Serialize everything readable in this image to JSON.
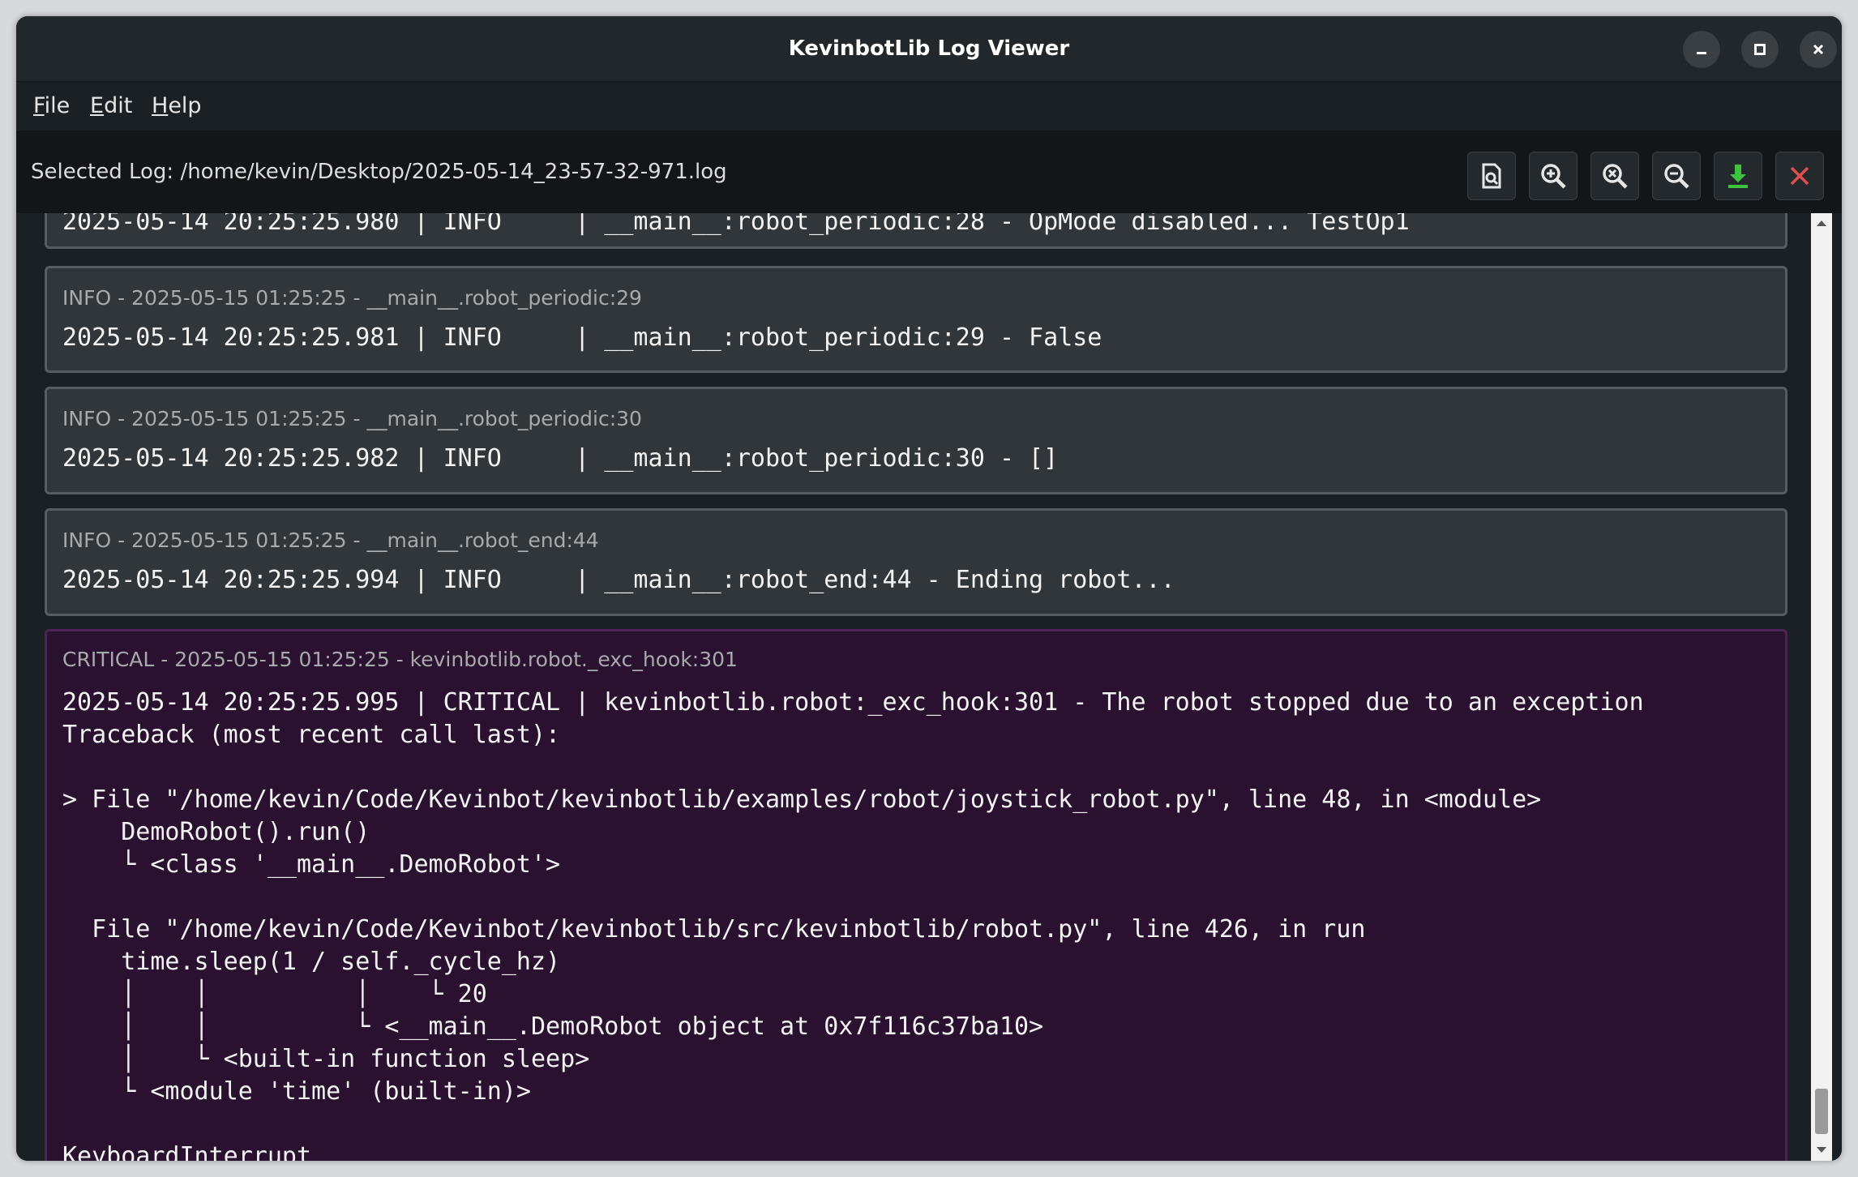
{
  "window": {
    "title": "KevinbotLib Log Viewer"
  },
  "menu": [
    {
      "accel": "F",
      "rest": "ile"
    },
    {
      "accel": "E",
      "rest": "dit"
    },
    {
      "accel": "H",
      "rest": "elp"
    }
  ],
  "toolbar": {
    "selected_log": "Selected Log: /home/kevin/Desktop/2025-05-14_23-57-32-971.log",
    "buttons": [
      "open-log-icon",
      "zoom-in-icon",
      "zoom-reset-icon",
      "zoom-out-icon",
      "download-icon",
      "close-log-icon"
    ]
  },
  "colors": {
    "window_bg": "#1b2024",
    "entry_bg": "#31363b",
    "entry_border": "#575c61",
    "critical_bg": "#2a1130",
    "critical_border": "#4d2356",
    "download_icon": "#3ec43e",
    "close_icon": "#e05050"
  },
  "entries": [
    {
      "level": "INFO",
      "header": "",
      "body": "2025-05-14 20:25:25.980 | INFO     | __main__:robot_periodic:28 - OpMode disabled... TestOp1"
    },
    {
      "level": "INFO",
      "header": "INFO - 2025-05-15 01:25:25 - __main__.robot_periodic:29",
      "body": "2025-05-14 20:25:25.981 | INFO     | __main__:robot_periodic:29 - False"
    },
    {
      "level": "INFO",
      "header": "INFO - 2025-05-15 01:25:25 - __main__.robot_periodic:30",
      "body": "2025-05-14 20:25:25.982 | INFO     | __main__:robot_periodic:30 - []"
    },
    {
      "level": "INFO",
      "header": "INFO - 2025-05-15 01:25:25 - __main__.robot_end:44",
      "body": "2025-05-14 20:25:25.994 | INFO     | __main__:robot_end:44 - Ending robot..."
    },
    {
      "level": "CRITICAL",
      "header": "CRITICAL - 2025-05-15 01:25:25 - kevinbotlib.robot._exc_hook:301",
      "body": "2025-05-14 20:25:25.995 | CRITICAL | kevinbotlib.robot:_exc_hook:301 - The robot stopped due to an exception\nTraceback (most recent call last):\n\n> File \"/home/kevin/Code/Kevinbot/kevinbotlib/examples/robot/joystick_robot.py\", line 48, in <module>\n    DemoRobot().run()\n    └ <class '__main__.DemoRobot'>\n\n  File \"/home/kevin/Code/Kevinbot/kevinbotlib/src/kevinbotlib/robot.py\", line 426, in run\n    time.sleep(1 / self._cycle_hz)\n    │    │          │    └ 20\n    │    │          └ <__main__.DemoRobot object at 0x7f116c37ba10>\n    │    └ <built-in function sleep>\n    └ <module 'time' (built-in)>\n\nKeyboardInterrupt"
    }
  ]
}
